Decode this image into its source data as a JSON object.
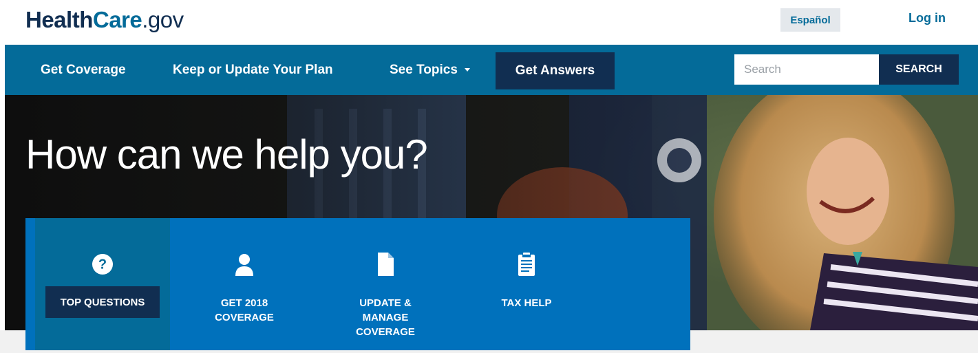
{
  "header": {
    "logo": {
      "part1": "Health",
      "part2": "Care",
      "part3": ".gov"
    },
    "espanol_label": "Español",
    "login_label": "Log in"
  },
  "nav": {
    "items": [
      {
        "label": "Get Coverage"
      },
      {
        "label": "Keep or Update Your Plan"
      },
      {
        "label": "See Topics",
        "has_dropdown": true
      },
      {
        "label": "Get Answers",
        "active": true
      }
    ],
    "search": {
      "placeholder": "Search",
      "button_label": "SEARCH"
    }
  },
  "hero": {
    "title": "How can we help you?"
  },
  "help_tiles": [
    {
      "label": "TOP QUESTIONS",
      "icon": "question-circle-icon",
      "active": true
    },
    {
      "label": "GET 2018 COVERAGE",
      "icon": "person-icon"
    },
    {
      "label": "UPDATE & MANAGE COVERAGE",
      "icon": "document-icon"
    },
    {
      "label": "TAX HELP",
      "icon": "clipboard-icon"
    }
  ],
  "colors": {
    "navy": "#112e51",
    "primary_blue": "#046b99",
    "tile_blue": "#0071bc",
    "espanol_bg": "#e4e8ec"
  }
}
